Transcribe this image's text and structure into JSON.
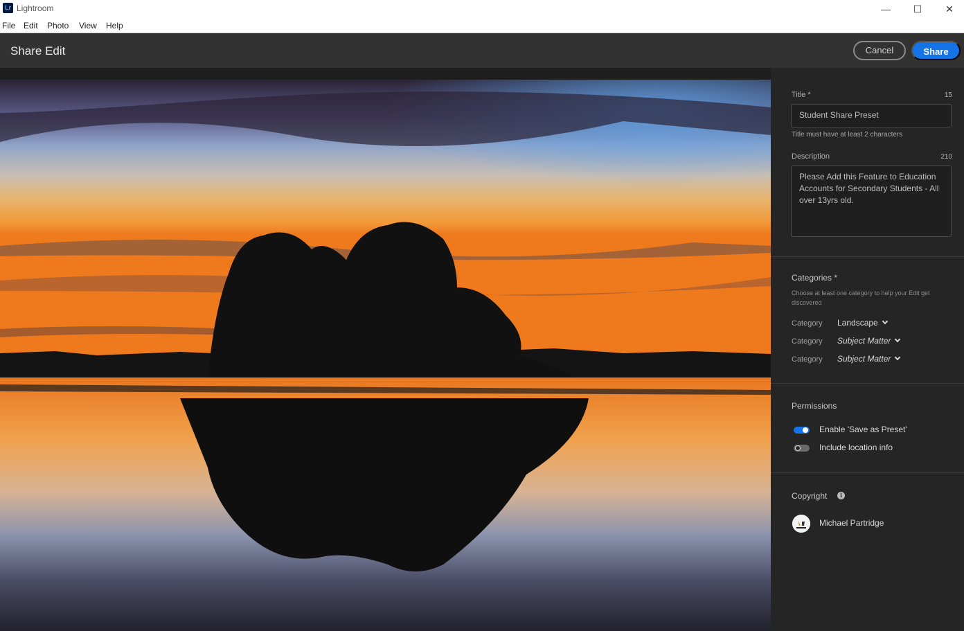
{
  "window": {
    "app_title": "Lightroom",
    "logo_text": "Lr",
    "minimize_glyph": "—",
    "maximize_glyph": "☐",
    "close_glyph": "✕"
  },
  "menu": [
    "File",
    "Edit",
    "Photo",
    "View",
    "Help"
  ],
  "header": {
    "title": "Share Edit",
    "cancel_label": "Cancel",
    "share_label": "Share",
    "share_color": "#1473e6"
  },
  "photo": {
    "icon": "sunset-lake-photo"
  },
  "form": {
    "title_label": "Title *",
    "title_counter": "15",
    "title_value": "Student Share Preset",
    "title_hint": "Title must have at least 2 characters",
    "description_label": "Description",
    "description_counter": "210",
    "description_value": "Please Add this Feature to Education Accounts for Secondary Students - All over 13yrs old."
  },
  "categories": {
    "title": "Categories *",
    "description": "Choose at least one category to help your Edit get discovered",
    "rows": [
      {
        "label": "Category",
        "value": "Landscape"
      },
      {
        "label": "Category",
        "value": "Subject Matter"
      },
      {
        "label": "Category",
        "value": "Subject Matter"
      }
    ]
  },
  "permissions": {
    "title": "Permissions",
    "toggles": [
      {
        "label": "Enable 'Save as Preset'",
        "on": true
      },
      {
        "label": "Include location info",
        "on": false
      }
    ]
  },
  "copyright": {
    "title": "Copyright",
    "info_glyph": "i",
    "owner": "Michael Partridge"
  }
}
